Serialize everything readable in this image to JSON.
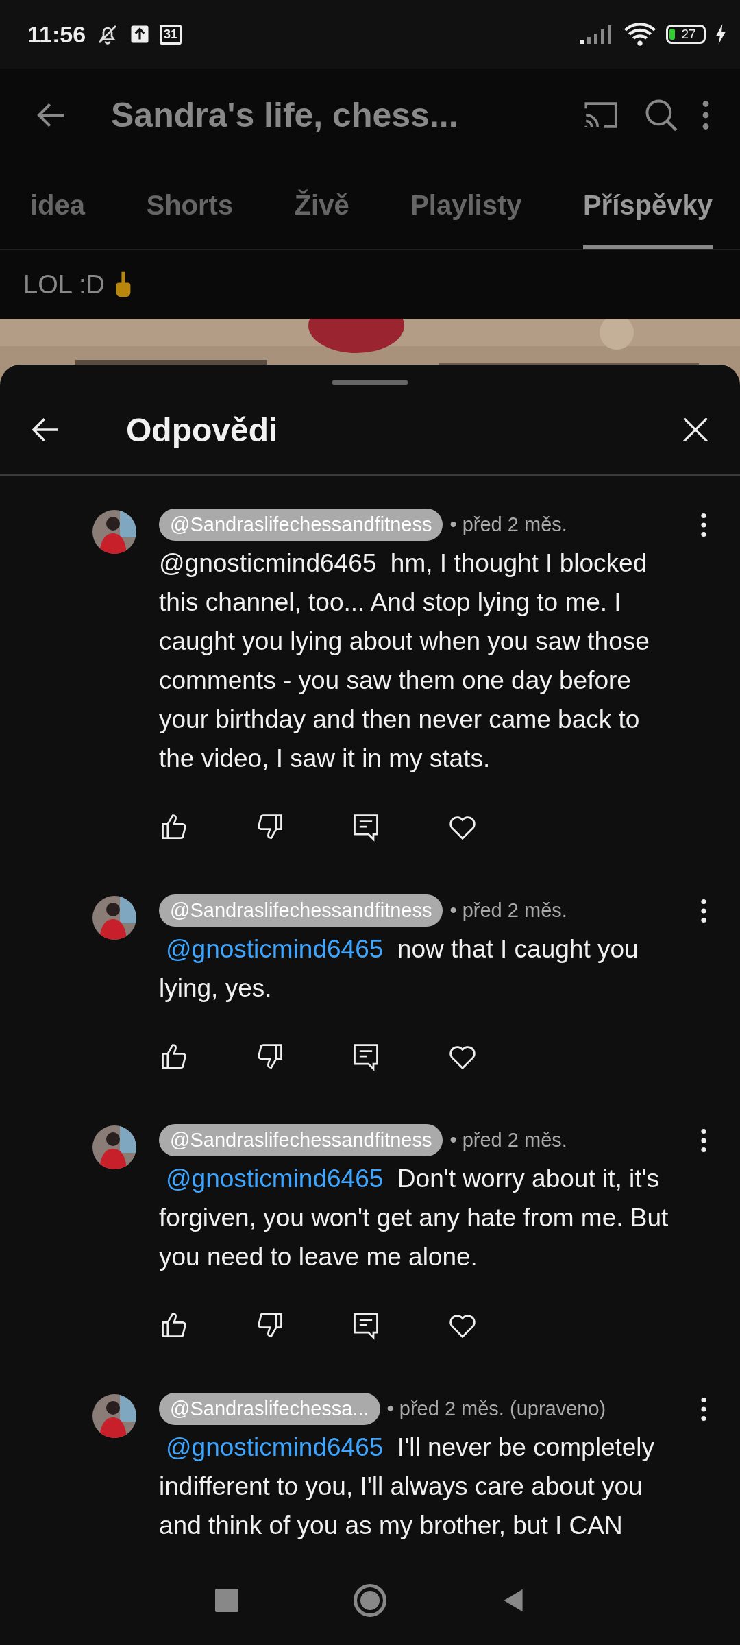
{
  "status_bar": {
    "time": "11:56",
    "calendar_day": "31",
    "battery": "27"
  },
  "app_bar": {
    "title": "Sandra's life, chess..."
  },
  "tabs": [
    {
      "label": "idea",
      "selected": false
    },
    {
      "label": "Shorts",
      "selected": false
    },
    {
      "label": "Živě",
      "selected": false
    },
    {
      "label": "Playlisty",
      "selected": false
    },
    {
      "label": "Příspěvky",
      "selected": true
    }
  ],
  "post": {
    "text": "LOL :D"
  },
  "sheet": {
    "title": "Odpovědi"
  },
  "replies": [
    {
      "author": "@Sandraslifechessandfitness",
      "time": "• před 2 měs.",
      "mention": {
        "text": "@gnosticmind6465",
        "linked": false
      },
      "text": "hm, I thought I blocked this channel, too... And stop lying to me. I caught you lying about when you saw those comments - you saw them one day before your birthday and then never came back to the video, I saw it in my stats."
    },
    {
      "author": "@Sandraslifechessandfitness",
      "time": "• před 2 měs.",
      "mention": {
        "text": "@gnosticmind6465",
        "linked": true
      },
      "text": "now that I caught you lying, yes."
    },
    {
      "author": "@Sandraslifechessandfitness",
      "time": "• před 2 měs.",
      "mention": {
        "text": "@gnosticmind6465",
        "linked": true
      },
      "text": "Don't worry about it, it's forgiven, you won't get any hate from me. But you need to leave me alone."
    },
    {
      "author": "@Sandraslifechessa...",
      "time": "• před 2 měs. (upraveno)",
      "mention": {
        "text": "@gnosticmind6465",
        "linked": true
      },
      "text": "I'll never be completely indifferent to you, I'll always care about you and think of you as my brother, but I CAN"
    }
  ]
}
